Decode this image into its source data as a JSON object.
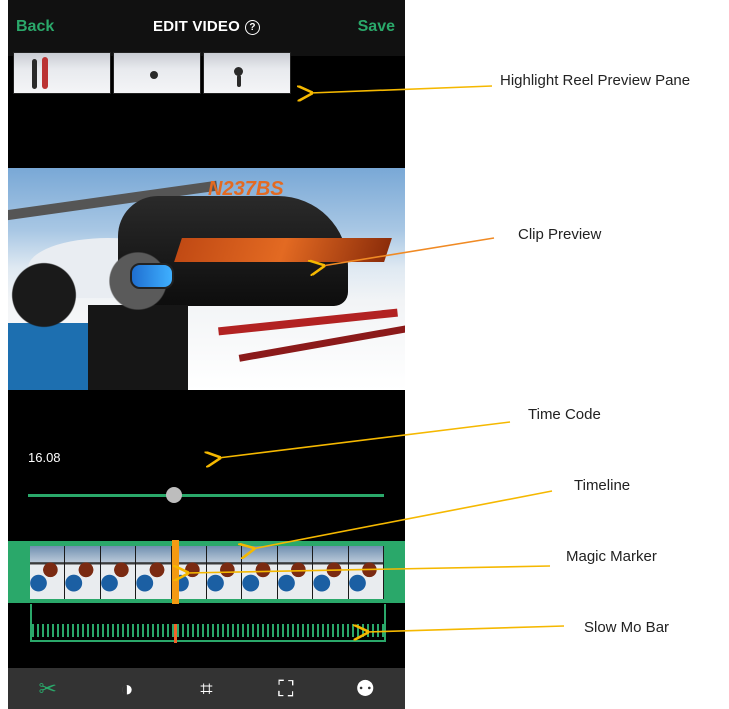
{
  "header": {
    "back_label": "Back",
    "title": "EDIT VIDEO",
    "help_icon_text": "?",
    "save_label": "Save"
  },
  "player": {
    "time_code": "16.08",
    "scrubber_position": 0.41,
    "magic_marker_position": 0.41,
    "slowmo_marker_position": 0.41
  },
  "annotations": {
    "highlight_reel": "Highlight Reel Preview Pane",
    "clip_preview": "Clip Preview",
    "time_code": "Time Code",
    "timeline": "Timeline",
    "magic_marker": "Magic Marker",
    "slow_mo_bar": "Slow Mo Bar"
  },
  "toolbar": {
    "tools": [
      {
        "name": "scissors-icon",
        "glyph": "✂",
        "active": true
      },
      {
        "name": "contrast-icon",
        "glyph": "◑",
        "active": false
      },
      {
        "name": "crop-icon",
        "glyph": "⌗",
        "active": false
      },
      {
        "name": "fullscreen-icon",
        "glyph": "⛶",
        "active": false
      },
      {
        "name": "filter-icon",
        "glyph": "⚉",
        "active": false
      }
    ]
  },
  "colors": {
    "accent": "#2aa86a",
    "marker": "#f39a12",
    "annotation_arrow": "#f5b800"
  }
}
